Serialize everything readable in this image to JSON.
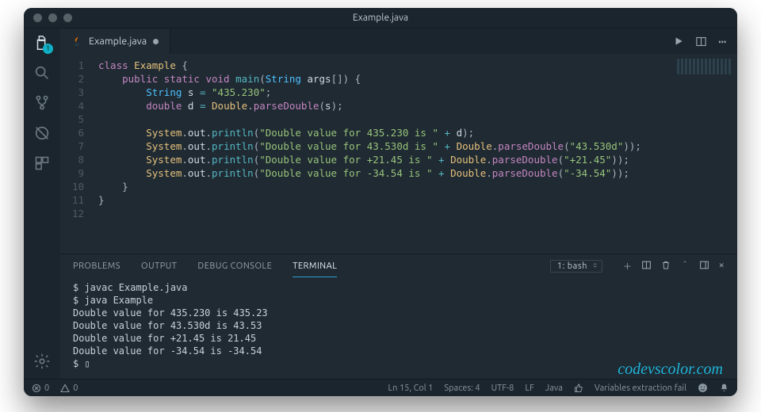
{
  "window": {
    "title": "Example.java"
  },
  "tab": {
    "icon": "java-file-icon",
    "label": "Example.java",
    "dirty": true
  },
  "activity": {
    "explorer_badge": "1"
  },
  "editor_actions": {
    "run": "▶",
    "split": "▣",
    "more": "⋯"
  },
  "code": {
    "line_count": 12,
    "tokens": [
      [
        [
          "kw",
          "class"
        ],
        [
          "punc",
          " "
        ],
        [
          "cls",
          "Example"
        ],
        [
          "punc",
          " {"
        ]
      ],
      [
        [
          "punc",
          "    "
        ],
        [
          "kw",
          "public"
        ],
        [
          "punc",
          " "
        ],
        [
          "kw",
          "static"
        ],
        [
          "punc",
          " "
        ],
        [
          "kw",
          "void"
        ],
        [
          "punc",
          " "
        ],
        [
          "fn",
          "main"
        ],
        [
          "punc",
          "("
        ],
        [
          "type",
          "String"
        ],
        [
          "punc",
          " "
        ],
        [
          "ident",
          "args"
        ],
        [
          "punc",
          "[]) {"
        ]
      ],
      [
        [
          "punc",
          "        "
        ],
        [
          "type",
          "String"
        ],
        [
          "punc",
          " "
        ],
        [
          "ident",
          "s"
        ],
        [
          "punc",
          " "
        ],
        [
          "op",
          "="
        ],
        [
          "punc",
          " "
        ],
        [
          "str",
          "\"435.230\""
        ],
        [
          "punc",
          ";"
        ]
      ],
      [
        [
          "punc",
          "        "
        ],
        [
          "kw",
          "double"
        ],
        [
          "punc",
          " "
        ],
        [
          "ident",
          "d"
        ],
        [
          "punc",
          " "
        ],
        [
          "op",
          "="
        ],
        [
          "punc",
          " "
        ],
        [
          "cls",
          "Double"
        ],
        [
          "punc",
          "."
        ],
        [
          "fn2",
          "parseDouble"
        ],
        [
          "punc",
          "("
        ],
        [
          "ident",
          "s"
        ],
        [
          "punc",
          ");"
        ]
      ],
      [],
      [
        [
          "punc",
          "        "
        ],
        [
          "cls",
          "System"
        ],
        [
          "punc",
          "."
        ],
        [
          "ident",
          "out"
        ],
        [
          "punc",
          "."
        ],
        [
          "fn",
          "println"
        ],
        [
          "punc",
          "("
        ],
        [
          "str",
          "\"Double value for 435.230 is \""
        ],
        [
          "punc",
          " "
        ],
        [
          "op",
          "+"
        ],
        [
          "punc",
          " "
        ],
        [
          "ident",
          "d"
        ],
        [
          "punc",
          ");"
        ]
      ],
      [
        [
          "punc",
          "        "
        ],
        [
          "cls",
          "System"
        ],
        [
          "punc",
          "."
        ],
        [
          "ident",
          "out"
        ],
        [
          "punc",
          "."
        ],
        [
          "fn",
          "println"
        ],
        [
          "punc",
          "("
        ],
        [
          "str",
          "\"Double value for 43.530d is \""
        ],
        [
          "punc",
          " "
        ],
        [
          "op",
          "+"
        ],
        [
          "punc",
          " "
        ],
        [
          "cls",
          "Double"
        ],
        [
          "punc",
          "."
        ],
        [
          "fn2",
          "parseDouble"
        ],
        [
          "punc",
          "("
        ],
        [
          "str",
          "\"43.530d\""
        ],
        [
          "punc",
          "));"
        ]
      ],
      [
        [
          "punc",
          "        "
        ],
        [
          "cls",
          "System"
        ],
        [
          "punc",
          "."
        ],
        [
          "ident",
          "out"
        ],
        [
          "punc",
          "."
        ],
        [
          "fn",
          "println"
        ],
        [
          "punc",
          "("
        ],
        [
          "str",
          "\"Double value for +21.45 is \""
        ],
        [
          "punc",
          " "
        ],
        [
          "op",
          "+"
        ],
        [
          "punc",
          " "
        ],
        [
          "cls",
          "Double"
        ],
        [
          "punc",
          "."
        ],
        [
          "fn2",
          "parseDouble"
        ],
        [
          "punc",
          "("
        ],
        [
          "str",
          "\"+21.45\""
        ],
        [
          "punc",
          "));"
        ]
      ],
      [
        [
          "punc",
          "        "
        ],
        [
          "cls",
          "System"
        ],
        [
          "punc",
          "."
        ],
        [
          "ident",
          "out"
        ],
        [
          "punc",
          "."
        ],
        [
          "fn",
          "println"
        ],
        [
          "punc",
          "("
        ],
        [
          "str",
          "\"Double value for -34.54 is \""
        ],
        [
          "punc",
          " "
        ],
        [
          "op",
          "+"
        ],
        [
          "punc",
          " "
        ],
        [
          "cls",
          "Double"
        ],
        [
          "punc",
          "."
        ],
        [
          "fn2",
          "parseDouble"
        ],
        [
          "punc",
          "("
        ],
        [
          "str",
          "\"-34.54\""
        ],
        [
          "punc",
          "));"
        ]
      ],
      [
        [
          "punc",
          "    }"
        ]
      ],
      [
        [
          "punc",
          "}"
        ]
      ],
      []
    ]
  },
  "panel": {
    "tabs": [
      "PROBLEMS",
      "OUTPUT",
      "DEBUG CONSOLE",
      "TERMINAL"
    ],
    "active_tab": 3,
    "select": "1: bash"
  },
  "terminal": {
    "lines": [
      "$ javac Example.java",
      "$ java Example",
      "Double value for 435.230 is 435.23",
      "Double value for 43.530d is 43.53",
      "Double value for +21.45 is 21.45",
      "Double value for -34.54 is -34.54",
      "$ ▯"
    ],
    "watermark": "codevscolor.com"
  },
  "status": {
    "errors": "0",
    "warnings": "0",
    "cursor": "Ln 15, Col 1",
    "spaces": "Spaces: 4",
    "encoding": "UTF-8",
    "eol": "LF",
    "lang": "Java",
    "tail": "Variables extraction fail"
  }
}
